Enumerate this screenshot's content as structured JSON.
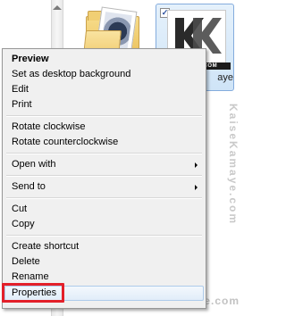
{
  "explorer": {
    "selected_file_label": "aye",
    "thumbnail_caption": "E.COM",
    "thumbnail_letters": "KK"
  },
  "watermark": {
    "vertical": "KaiseKamaye.com",
    "bottom": "KaiseKamaye.com"
  },
  "context_menu": {
    "items": [
      {
        "label": "Preview",
        "bold": true
      },
      {
        "label": "Set as desktop background"
      },
      {
        "label": "Edit"
      },
      {
        "label": "Print"
      },
      {
        "label": "Rotate clockwise"
      },
      {
        "label": "Rotate counterclockwise"
      },
      {
        "label": "Open with",
        "submenu": true
      },
      {
        "label": "Send to",
        "submenu": true
      },
      {
        "label": "Cut"
      },
      {
        "label": "Copy"
      },
      {
        "label": "Create shortcut"
      },
      {
        "label": "Delete"
      },
      {
        "label": "Rename"
      },
      {
        "label": "Properties",
        "highlighted": true
      }
    ]
  },
  "colors": {
    "highlight_outline": "#e3202a",
    "menu_background": "#f0f0f0",
    "selection_border": "#84acdd"
  }
}
